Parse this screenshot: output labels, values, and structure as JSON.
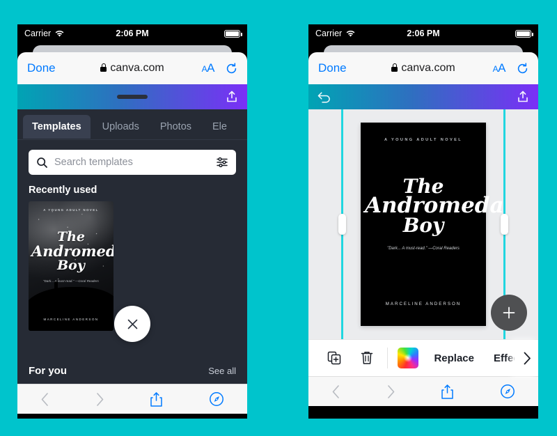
{
  "background_color": "#00C4CC",
  "status_bar": {
    "carrier": "Carrier",
    "wifi_icon": "wifi-icon",
    "time": "2:06 PM",
    "battery_icon": "battery-full-icon"
  },
  "safari_bar": {
    "done_label": "Done",
    "lock_icon": "lock-icon",
    "url": "canva.com",
    "text_size_label": "AA",
    "reload_icon": "reload-icon"
  },
  "safari_bottom": {
    "back_icon": "chevron-left-icon",
    "forward_icon": "chevron-right-icon",
    "share_icon": "share-icon",
    "tabs_icon": "compass-icon"
  },
  "left_phone": {
    "app_bar": {
      "drag_handle": "drag-handle",
      "share_icon": "share-upload-icon"
    },
    "tabs": [
      {
        "label": "Templates",
        "active": true
      },
      {
        "label": "Uploads",
        "active": false
      },
      {
        "label": "Photos",
        "active": false
      },
      {
        "label": "Ele",
        "active": false
      }
    ],
    "search": {
      "icon": "search-icon",
      "placeholder": "Search templates",
      "filter_icon": "filter-sliders-icon"
    },
    "recently_used_title": "Recently used",
    "for_you_title": "For you",
    "see_all_label": "See all",
    "close_button_icon": "close-icon"
  },
  "right_phone": {
    "app_bar": {
      "undo_icon": "undo-icon",
      "share_icon": "share-upload-icon"
    },
    "selection": {
      "left_guide_handle": "resize-handle-left",
      "right_guide_handle": "resize-handle-right",
      "guide_color": "#21D6E0"
    },
    "add_button_icon": "plus-icon",
    "edit_toolbar": {
      "duplicate_icon": "duplicate-icon",
      "delete_icon": "trash-icon",
      "color_swatch_icon": "color-wheel-icon",
      "replace_label": "Replace",
      "effects_label": "Effects",
      "more_icon": "chevron-right-icon"
    }
  },
  "book_cover": {
    "kicker": "A YOUNG ADULT NOVEL",
    "title_line1": "The",
    "title_line2": "Andromeda",
    "title_line3": "Boy",
    "quote": "\"Dark... A must-read.\" —Coral Readers",
    "author": "MARCELINE ANDERSON"
  }
}
